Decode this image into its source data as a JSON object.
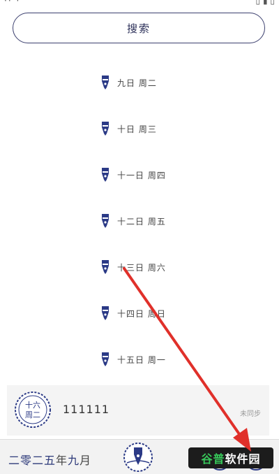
{
  "search": {
    "label": "搜索"
  },
  "dates": [
    {
      "label": "九日 周二"
    },
    {
      "label": "十日 周三"
    },
    {
      "label": "十一日 周四"
    },
    {
      "label": "十二日 周五"
    },
    {
      "label": "十三日 周六"
    },
    {
      "label": "十四日 周日"
    },
    {
      "label": "十五日 周一"
    }
  ],
  "card": {
    "stamp_top": "十六",
    "stamp_bottom": "周二",
    "title": "111111",
    "status": "未同步"
  },
  "bottom": {
    "month_parts": [
      "二零二五",
      "年",
      "九",
      "月"
    ]
  },
  "watermark": {
    "part1": "谷普",
    "part2": "软件园"
  },
  "colors": {
    "accent": "#2b3a86",
    "arrow": "#e0302a"
  }
}
